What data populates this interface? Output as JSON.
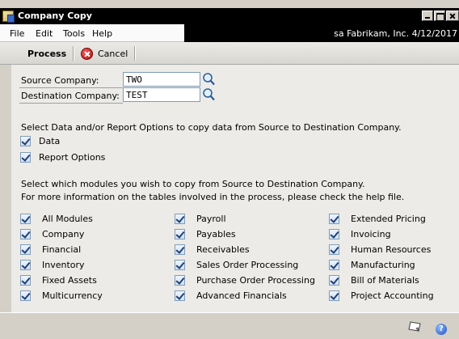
{
  "window": {
    "title": "Company Copy"
  },
  "menu": {
    "items": [
      "File",
      "Edit",
      "Tools",
      "Help"
    ],
    "info": "sa  Fabrikam, Inc.  4/12/2017"
  },
  "toolbar": {
    "process_label": "Process",
    "cancel_label": "Cancel"
  },
  "fields": {
    "source": {
      "label": "Source Company:",
      "value": "TWO"
    },
    "destination": {
      "label": "Destination Company:",
      "value": "TEST"
    }
  },
  "options": {
    "instruction": "Select Data and/or Report Options to copy data from Source to Destination Company.",
    "items": [
      {
        "label": "Data",
        "checked": true
      },
      {
        "label": "Report Options",
        "checked": true
      }
    ]
  },
  "modules": {
    "instruction_line1": "Select which modules you wish to copy from Source to Destination Company.",
    "instruction_line2": "For more information on the tables involved in the process, please check the help file.",
    "columns": [
      [
        {
          "label": "All Modules",
          "checked": true
        },
        {
          "label": "Company",
          "checked": true
        },
        {
          "label": "Financial",
          "checked": true
        },
        {
          "label": "Inventory",
          "checked": true
        },
        {
          "label": "Fixed Assets",
          "checked": true
        },
        {
          "label": "Multicurrency",
          "checked": true
        }
      ],
      [
        {
          "label": "Payroll",
          "checked": true
        },
        {
          "label": "Payables",
          "checked": true
        },
        {
          "label": "Receivables",
          "checked": true
        },
        {
          "label": "Sales Order Processing",
          "checked": true
        },
        {
          "label": "Purchase Order Processing",
          "checked": true
        },
        {
          "label": "Advanced Financials",
          "checked": true
        }
      ],
      [
        {
          "label": "Extended Pricing",
          "checked": true
        },
        {
          "label": "Invoicing",
          "checked": true
        },
        {
          "label": "Human Resources",
          "checked": true
        },
        {
          "label": "Manufacturing",
          "checked": true
        },
        {
          "label": "Bill of Materials",
          "checked": true
        },
        {
          "label": "Project Accounting",
          "checked": true
        }
      ]
    ]
  },
  "icons": {
    "app": "company-copy-icon",
    "cancel": "cancel-icon",
    "lookup": "lookup-icon",
    "note": "note-icon",
    "help": "help-icon"
  }
}
